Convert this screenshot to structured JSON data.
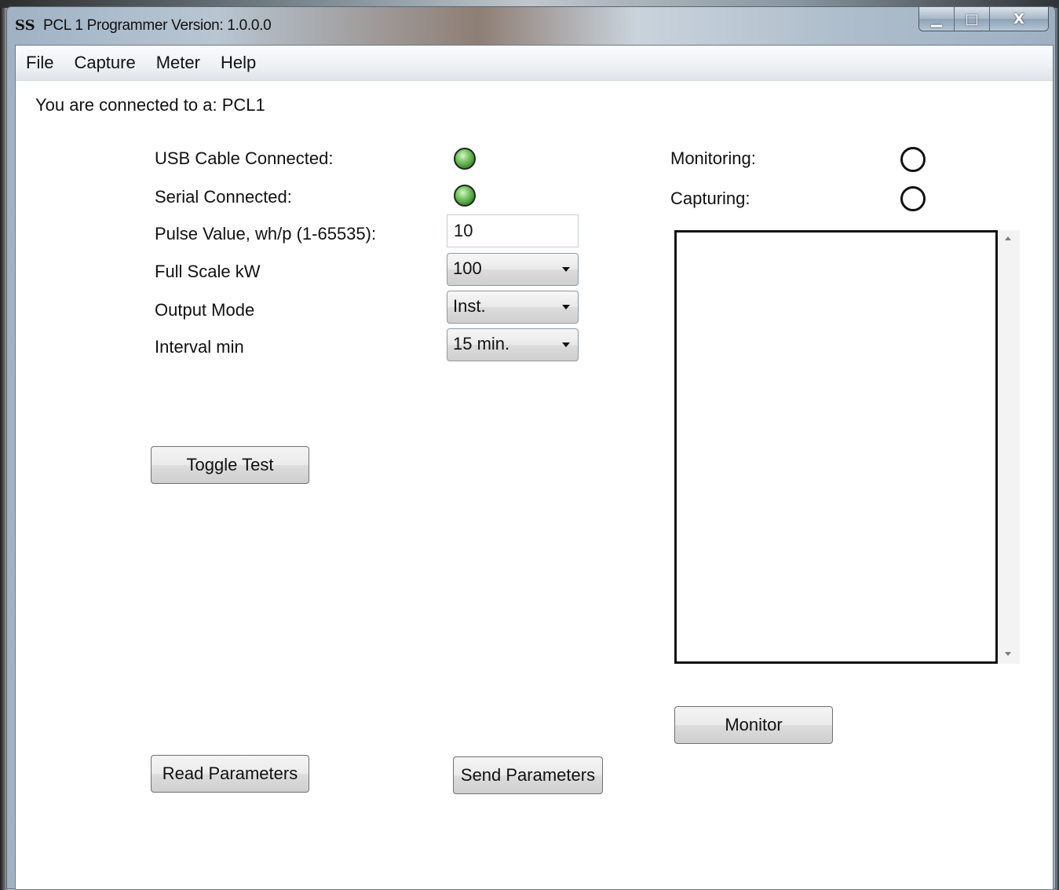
{
  "window": {
    "title": "PCL 1 Programmer Version: 1.0.0.0",
    "app_icon_glyph": "SS",
    "minimize_glyph": "▁",
    "maximize_glyph": "□",
    "close_glyph": "X"
  },
  "menubar": {
    "items": [
      "File",
      "Capture",
      "Meter",
      "Help"
    ]
  },
  "connection": {
    "text": "You are connected to a:  PCL1"
  },
  "status": {
    "usb_label": "USB Cable Connected:",
    "usb_on": true,
    "serial_label": "Serial Connected:",
    "serial_on": true,
    "monitoring_label": "Monitoring:",
    "monitoring_on": false,
    "capturing_label": "Capturing:",
    "capturing_on": false,
    "led_on_color": "#3b8a2c"
  },
  "params": {
    "pulse_label": "Pulse Value, wh/p (1-65535):",
    "pulse_value": "10",
    "full_scale_label": "Full Scale kW",
    "full_scale_value": "100",
    "output_mode_label": "Output Mode",
    "output_mode_value": "Inst.",
    "interval_label": "Interval min",
    "interval_value": "15 min."
  },
  "buttons": {
    "toggle_test": "Toggle Test",
    "monitor": "Monitor",
    "read_parameters": "Read Parameters",
    "send_parameters": "Send Parameters"
  }
}
